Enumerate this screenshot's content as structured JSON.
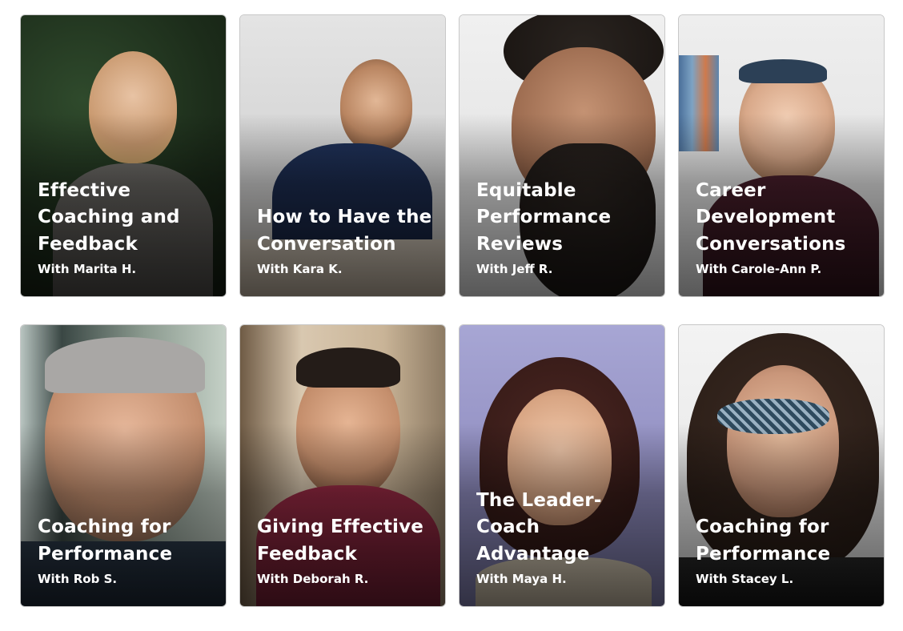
{
  "courses": [
    {
      "title": "Effective Coaching and Feedback",
      "instructor": "With Marita H."
    },
    {
      "title": "How to Have the Conversation",
      "instructor": "With Kara K."
    },
    {
      "title": "Equitable Performance Reviews",
      "instructor": "With Jeff R."
    },
    {
      "title": "Career Development Conversations",
      "instructor": "With Carole-Ann P."
    },
    {
      "title": "Coaching for Performance",
      "instructor": "With Rob S."
    },
    {
      "title": "Giving Effective Feedback",
      "instructor": "With Deborah R."
    },
    {
      "title": "The Leader-Coach Advantage",
      "instructor": "With Maya H."
    },
    {
      "title": "Coaching for Performance",
      "instructor": "With Stacey L."
    }
  ],
  "colors": {
    "card_text": "#ffffff",
    "card_border": "#c8c8c8"
  }
}
